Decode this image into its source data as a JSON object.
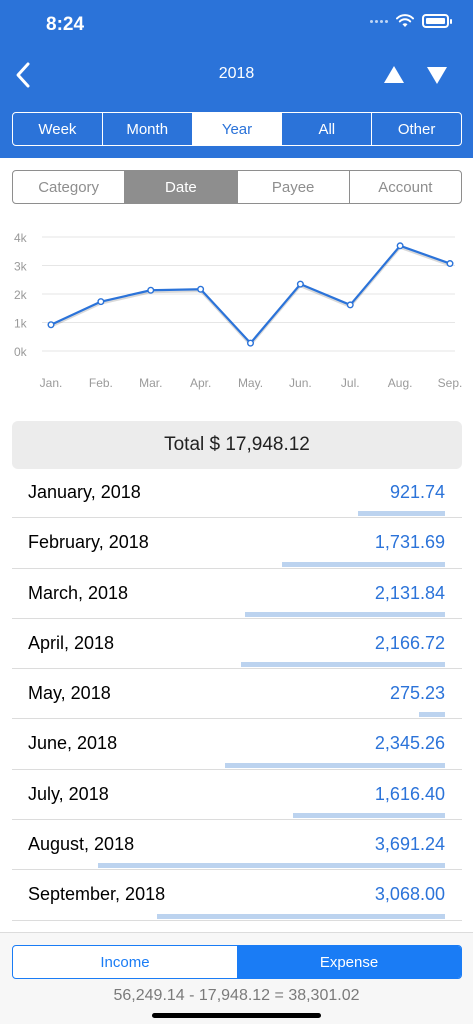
{
  "status": {
    "time": "8:24"
  },
  "nav": {
    "title": "2018"
  },
  "period_tabs": [
    {
      "label": "Week",
      "active": false
    },
    {
      "label": "Month",
      "active": false
    },
    {
      "label": "Year",
      "active": true
    },
    {
      "label": "All",
      "active": false
    },
    {
      "label": "Other",
      "active": false
    }
  ],
  "group_tabs": [
    {
      "label": "Category",
      "active": false
    },
    {
      "label": "Date",
      "active": true
    },
    {
      "label": "Payee",
      "active": false
    },
    {
      "label": "Account",
      "active": false
    }
  ],
  "chart_data": {
    "type": "line",
    "x": [
      "Jan.",
      "Feb.",
      "Mar.",
      "Apr.",
      "May.",
      "Jun.",
      "Jul.",
      "Aug.",
      "Sep."
    ],
    "series": [
      {
        "values": [
          921.74,
          1731.69,
          2131.84,
          2166.72,
          275.23,
          2345.26,
          1616.4,
          3691.24,
          3068.0
        ]
      }
    ],
    "yticks": [
      "4k",
      "3k",
      "2k",
      "1k",
      "0k"
    ],
    "ylim": [
      0,
      4000
    ],
    "grid": true,
    "color": "#2b73d9"
  },
  "total": {
    "label": "Total $ 17,948.12"
  },
  "rows": [
    {
      "label": "January, 2018",
      "value": "921.74",
      "amount": 921.74
    },
    {
      "label": "February, 2018",
      "value": "1,731.69",
      "amount": 1731.69
    },
    {
      "label": "March, 2018",
      "value": "2,131.84",
      "amount": 2131.84
    },
    {
      "label": "April, 2018",
      "value": "2,166.72",
      "amount": 2166.72
    },
    {
      "label": "May, 2018",
      "value": "275.23",
      "amount": 275.23
    },
    {
      "label": "June, 2018",
      "value": "2,345.26",
      "amount": 2345.26
    },
    {
      "label": "July, 2018",
      "value": "1,616.40",
      "amount": 1616.4
    },
    {
      "label": "August, 2018",
      "value": "3,691.24",
      "amount": 3691.24
    },
    {
      "label": "September, 2018",
      "value": "3,068.00",
      "amount": 3068.0
    }
  ],
  "bottom": {
    "income_label": "Income",
    "expense_label": "Expense",
    "active": "expense",
    "summary": "56,249.14 - 17,948.12 = 38,301.02"
  },
  "colors": {
    "header": "#2b73d9",
    "accent": "#1a7cf5",
    "bar": "#bcd3ef"
  }
}
